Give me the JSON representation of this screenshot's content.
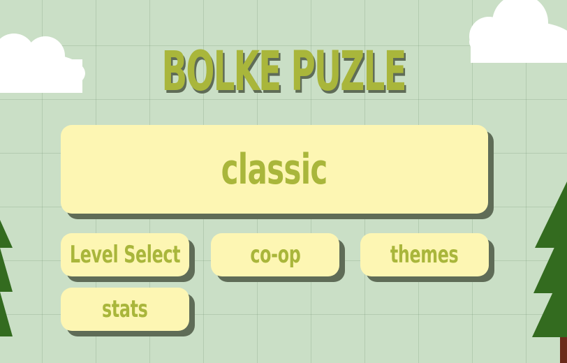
{
  "title": "BOLKE PUZLE",
  "menu": {
    "classic": "classic",
    "level_select": "Level Select",
    "coop": "co-op",
    "themes": "themes",
    "stats": "stats"
  },
  "scenery": {
    "clouds": [
      "cloud-icon",
      "cloud-icon"
    ],
    "trees": [
      "pine-tree-icon",
      "pine-tree-icon"
    ]
  },
  "colors": {
    "background": "#cadfc6",
    "button_fill": "#fdf6b3",
    "text_accent": "#a9b63b",
    "shadow": "#5f6c57",
    "tree_green": "#336b1f",
    "trunk": "#6b2a1a"
  }
}
